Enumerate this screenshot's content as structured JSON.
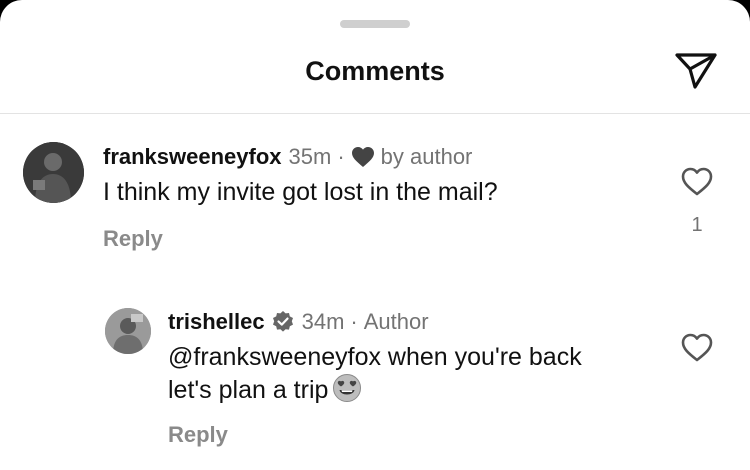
{
  "header": {
    "title": "Comments"
  },
  "comments": [
    {
      "username": "franksweeneyfox",
      "time": "35m",
      "by_author": "by author",
      "text": "I think my invite got lost in the mail?",
      "reply_label": "Reply",
      "like_count": "1"
    },
    {
      "username": "trishellec",
      "time": "34m",
      "role": "Author",
      "text_line1": "@franksweeneyfox when you're back",
      "text_line2": "let's plan a trip",
      "reply_label": "Reply"
    }
  ],
  "icons": {
    "share": "send-icon",
    "like": "heart-outline-icon",
    "author_like": "heart-filled-icon",
    "verified": "verified-badge-icon",
    "emoji": "smiling-face-with-heart-eyes-emoji"
  }
}
